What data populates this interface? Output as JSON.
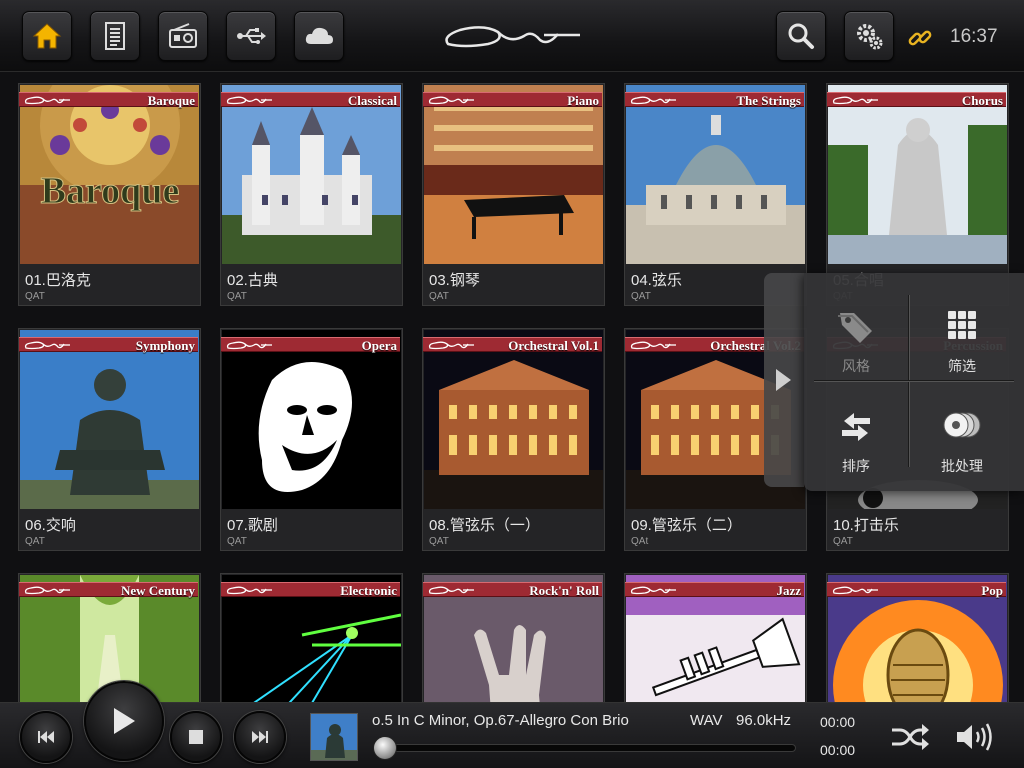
{
  "topbar": {
    "buttons": [
      {
        "name": "home-icon",
        "active": true
      },
      {
        "name": "document-icon"
      },
      {
        "name": "radio-icon"
      },
      {
        "name": "usb-icon"
      },
      {
        "name": "cloud-icon"
      }
    ],
    "right_buttons": [
      {
        "name": "search-icon"
      },
      {
        "name": "gear-icon"
      }
    ],
    "time": "16:37",
    "link_color": "#e8b321"
  },
  "albums": [
    {
      "banner": "Baroque",
      "title": "01.巴洛克",
      "subtitle": "QAT",
      "art": "baroque"
    },
    {
      "banner": "Classical",
      "title": "02.古典",
      "subtitle": "QAT",
      "art": "castle"
    },
    {
      "banner": "Piano",
      "title": "03.钢琴",
      "subtitle": "QAT",
      "art": "piano"
    },
    {
      "banner": "The Strings",
      "title": "04.弦乐",
      "subtitle": "QAT",
      "art": "dome"
    },
    {
      "banner": "Chorus",
      "title": "05.合唱",
      "subtitle": "QAT",
      "art": "statue"
    },
    {
      "banner": "Symphony",
      "title": "06.交响",
      "subtitle": "QAT",
      "art": "beethoven"
    },
    {
      "banner": "Opera",
      "title": "07.歌剧",
      "subtitle": "QAT",
      "art": "opera"
    },
    {
      "banner": "Orchestral Vol.1",
      "title": "08.管弦乐（一）",
      "subtitle": "QAT",
      "art": "hall"
    },
    {
      "banner": "Orchestral Vol.2",
      "title": "09.管弦乐（二）",
      "subtitle": "QAt",
      "art": "hall"
    },
    {
      "banner": "Percussion",
      "title": "10.打击乐",
      "subtitle": "QAT",
      "art": "drum"
    },
    {
      "banner": "New Century",
      "title": "",
      "subtitle": "",
      "art": "trees"
    },
    {
      "banner": "Electronic",
      "title": "",
      "subtitle": "",
      "art": "laser"
    },
    {
      "banner": "Rock'n' Roll",
      "title": "",
      "subtitle": "",
      "art": "rock"
    },
    {
      "banner": "Jazz",
      "title": "",
      "subtitle": "",
      "art": "trumpet"
    },
    {
      "banner": "Pop",
      "title": "",
      "subtitle": "",
      "art": "mic"
    }
  ],
  "popup": {
    "items": [
      {
        "label": "风格",
        "icon": "tag-icon",
        "disabled": true
      },
      {
        "label": "筛选",
        "icon": "grid-icon",
        "disabled": false
      },
      {
        "label": "排序",
        "icon": "sort-arrows-icon",
        "disabled": false
      },
      {
        "label": "批处理",
        "icon": "discs-icon",
        "disabled": false
      }
    ]
  },
  "player": {
    "track": "o.5 In C Minor, Op.67-Allegro Con Brio",
    "format": "WAV",
    "sample_rate": "96.0kHz",
    "elapsed": "00:00",
    "total": "00:00",
    "progress": 0.0
  }
}
